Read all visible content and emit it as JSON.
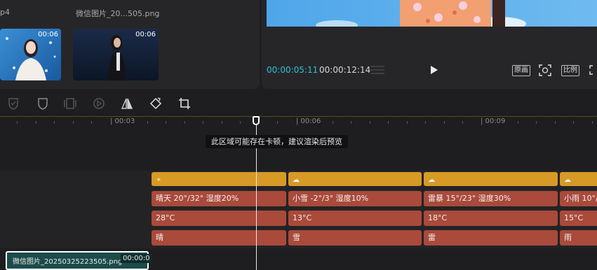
{
  "media": {
    "top_names": [
      "p4",
      "微信图片_20...505.png"
    ],
    "thumbs": [
      {
        "duration": "00:06"
      },
      {
        "duration": "00:06"
      }
    ]
  },
  "player": {
    "current_time": "00:00:05:11",
    "total_time": "00:00:12:14",
    "original_label": "原画",
    "ratio_label": "比例"
  },
  "timeline": {
    "ticks": [
      "| 00:03",
      "| 00:06",
      "| 00:09"
    ],
    "tooltip": "此区域可能存在卡顿，建议渲染后预览",
    "row2": [
      "晴天   20°/32° 湿度20%",
      "小雪   -2°/3° 湿度10%",
      "雷暴   15°/23° 湿度30%",
      "小雨    10°/"
    ],
    "row3": [
      "28°C",
      "13°C",
      "18°C",
      "15°C"
    ],
    "row4": [
      "晴",
      "雪",
      "雷",
      "雨"
    ],
    "main_clip": {
      "name": "微信图片_20250325223505.png",
      "duration": "00:00:0"
    }
  },
  "colors": {
    "accent_cyan": "#2fc4d0",
    "yellow_clip": "#d79a27",
    "red_clip": "#a94a3b"
  }
}
